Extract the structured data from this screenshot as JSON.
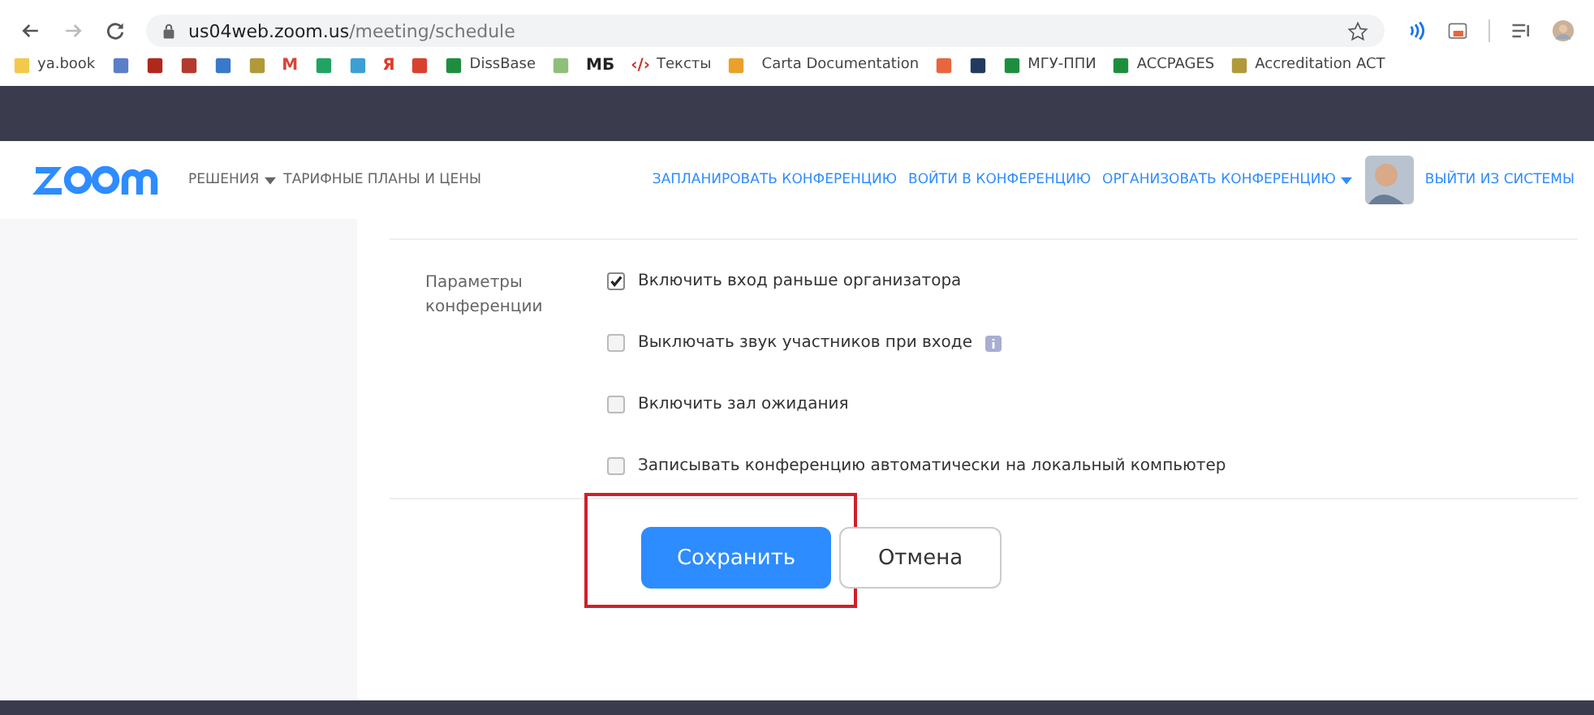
{
  "browser": {
    "url_host": "us04web.zoom.us",
    "url_path": "/meeting/schedule"
  },
  "bookmarks": [
    {
      "kind": "folder",
      "label": "ya.book",
      "color": "#f2c94c"
    },
    {
      "kind": "tile",
      "color": "#5b7fc9"
    },
    {
      "kind": "tile",
      "color": "#b0281c"
    },
    {
      "kind": "tile",
      "color": "#b23a2e"
    },
    {
      "kind": "tile",
      "color": "#3a79c9"
    },
    {
      "kind": "tile",
      "color": "#b09a3a"
    },
    {
      "kind": "glyph",
      "glyph": "M",
      "color": "#d44638"
    },
    {
      "kind": "tile",
      "color": "#1fa463"
    },
    {
      "kind": "tile",
      "color": "#3aa0d6"
    },
    {
      "kind": "glyph",
      "glyph": "Я",
      "color": "#e23a2a"
    },
    {
      "kind": "tile",
      "color": "#d9412f"
    },
    {
      "kind": "tile",
      "label": "DissBase",
      "color": "#1e8e3e"
    },
    {
      "kind": "tile",
      "color": "#8fbf7a"
    },
    {
      "kind": "glyph",
      "glyph": "МБ",
      "color": "#222222"
    },
    {
      "kind": "glyph",
      "glyph": "‹/›",
      "label": "Тексты",
      "color": "#c0392b"
    },
    {
      "kind": "tile",
      "color": "#e9a12b"
    },
    {
      "kind": "plain",
      "label": "Carta Documentation"
    },
    {
      "kind": "tile",
      "color": "#e8663d"
    },
    {
      "kind": "tile",
      "color": "#233a5e"
    },
    {
      "kind": "tile",
      "label": "МГУ-ППИ",
      "color": "#1e8e3e"
    },
    {
      "kind": "tile",
      "label": "ACCPAGES",
      "color": "#1e8e3e"
    },
    {
      "kind": "tile",
      "label": "Accreditation ACT",
      "color": "#b09a3a"
    }
  ],
  "nav": {
    "left": [
      {
        "label": "РЕШЕНИЯ",
        "dropdown": true
      },
      {
        "label": "ТАРИФНЫЕ ПЛАНЫ И ЦЕНЫ",
        "dropdown": false
      }
    ],
    "right": [
      {
        "label": "ЗАПЛАНИРОВАТЬ КОНФЕРЕНЦИЮ",
        "dropdown": false
      },
      {
        "label": "ВОЙТИ В КОНФЕРЕНЦИЮ",
        "dropdown": false
      },
      {
        "label": "ОРГАНИЗОВАТЬ КОНФЕРЕНЦИЮ",
        "dropdown": true
      }
    ],
    "signout": "ВЫЙТИ ИЗ СИСТЕМЫ"
  },
  "options": {
    "label": "Параметры конференции",
    "items": [
      {
        "label": "Включить вход раньше организатора",
        "checked": true,
        "info": false
      },
      {
        "label": "Выключать звук участников при входе",
        "checked": false,
        "info": true
      },
      {
        "label": "Включить зал ожидания",
        "checked": false,
        "info": false
      },
      {
        "label": "Записывать конференцию автоматически на локальный компьютер",
        "checked": false,
        "info": false
      }
    ]
  },
  "buttons": [
    {
      "label": "Сохранить",
      "kind": "primary",
      "highlighted": true
    },
    {
      "label": "Отмена",
      "kind": "secondary",
      "highlighted": false
    }
  ]
}
